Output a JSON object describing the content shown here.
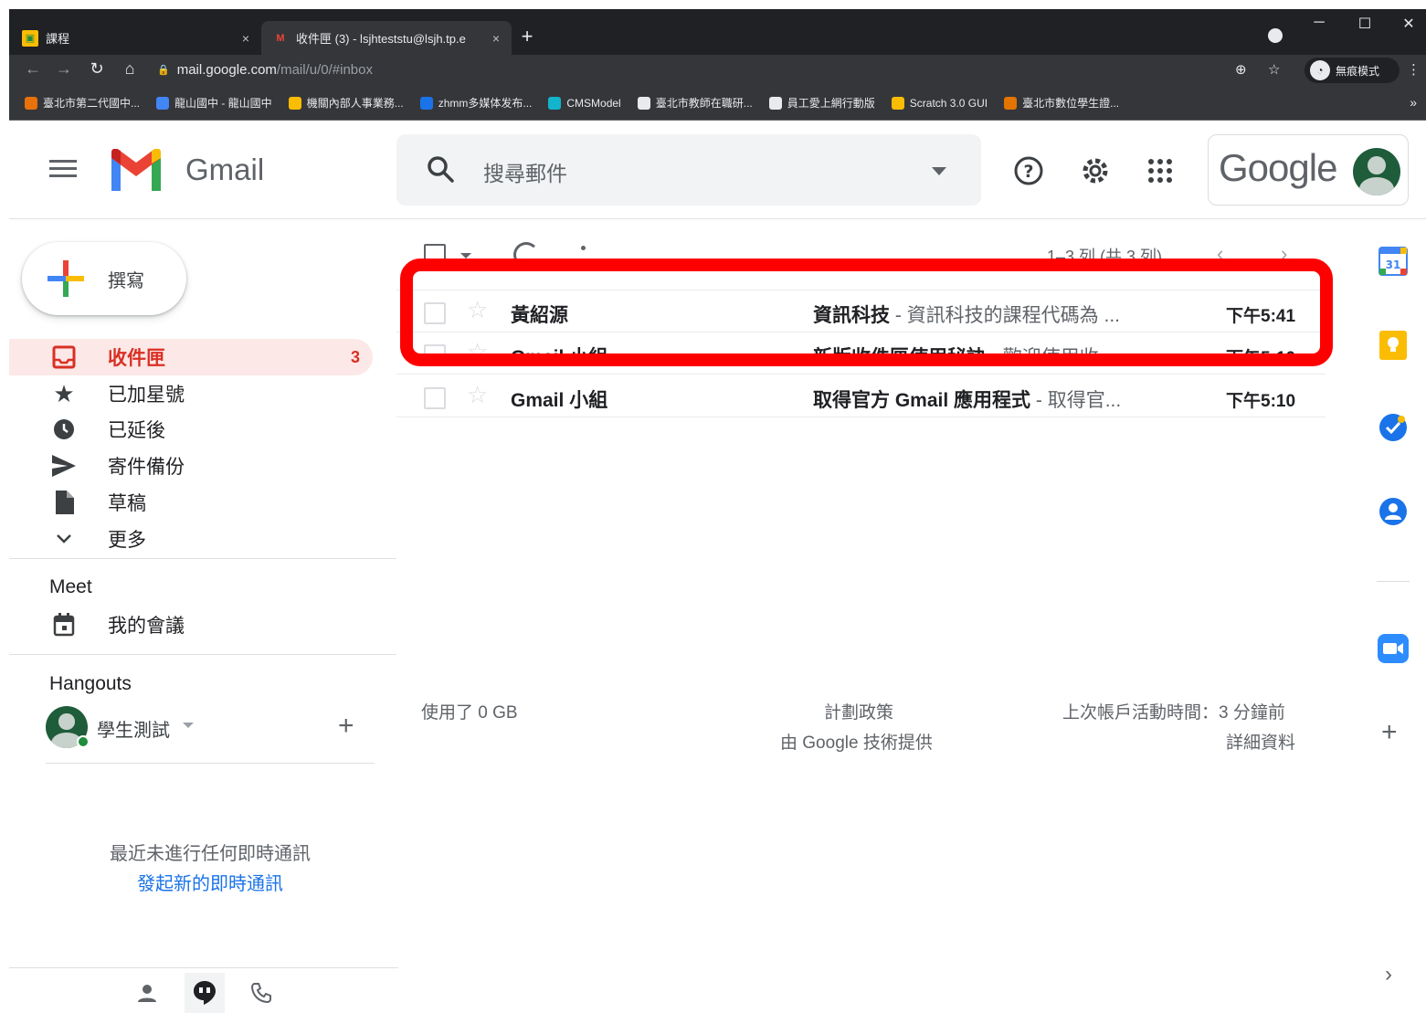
{
  "browser": {
    "tabs": [
      {
        "title": "課程",
        "close": "×"
      },
      {
        "title": "收件匣 (3) - lsjhteststu@lsjh.tp.e",
        "close": "×"
      }
    ],
    "new_tab": "+",
    "window_controls": [
      "─",
      "☐",
      "✕"
    ],
    "url_host": "mail.google.com",
    "url_path": "/mail/u/0/#inbox",
    "incognito_label": "無痕模式",
    "bookmarks": [
      {
        "label": "臺北市第二代國中...",
        "color": "#e8710a"
      },
      {
        "label": "龍山國中 - 龍山國中",
        "color": "#4285f4"
      },
      {
        "label": "機關內部人事業務...",
        "color": "#fbbc04"
      },
      {
        "label": "zhmm多媒体发布...",
        "color": "#1a73e8"
      },
      {
        "label": "CMSModel",
        "color": "#12b5cb"
      },
      {
        "label": "臺北市教師在職研...",
        "color": "#e8eaed"
      },
      {
        "label": "員工愛上網行動版",
        "color": "#e8eaed"
      },
      {
        "label": "Scratch 3.0 GUI",
        "color": "#fbbc04"
      },
      {
        "label": "臺北市數位學生證...",
        "color": "#e37400"
      }
    ],
    "bookmarks_more": "»"
  },
  "header": {
    "app_name": "Gmail",
    "search_placeholder": "搜尋郵件",
    "google_label": "Google"
  },
  "sidebar": {
    "compose_label": "撰寫",
    "items": [
      {
        "label": "收件匣",
        "count": "3",
        "icon": "inbox-icon"
      },
      {
        "label": "已加星號",
        "count": "",
        "icon": "star-icon"
      },
      {
        "label": "已延後",
        "count": "",
        "icon": "clock-icon"
      },
      {
        "label": "寄件備份",
        "count": "",
        "icon": "send-icon"
      },
      {
        "label": "草稿",
        "count": "",
        "icon": "draft-icon"
      },
      {
        "label": "更多",
        "count": "",
        "icon": "chevron-down-icon"
      }
    ],
    "meet_title": "Meet",
    "meet_item": "我的會議",
    "hangouts_title": "Hangouts",
    "hangouts_user": "學生測試",
    "no_chat": "最近未進行任何即時通訊",
    "new_chat": "發起新的即時通訊"
  },
  "list": {
    "pager": "1–3 列 (共 3 列)",
    "rows": [
      {
        "sender": "黃紹源",
        "subject": "資訊科技",
        "snippet": " - 資訊科技的課程代碼為 ...",
        "time": "下午5:41"
      },
      {
        "sender": "Gmail 小組",
        "subject": "新版收件匣使用秘訣",
        "snippet": " - 歡迎使用收...",
        "time": "下午5:10"
      },
      {
        "sender": "Gmail 小組",
        "subject": "取得官方 Gmail 應用程式",
        "snippet": " - 取得官...",
        "time": "下午5:10"
      }
    ]
  },
  "footer": {
    "storage": "使用了 0 GB",
    "policy": "計劃政策",
    "powered": "由 Google 技術提供",
    "activity": "上次帳戶活動時間：3 分鐘前",
    "details": "詳細資料"
  },
  "colors": {
    "accent_red": "#d93025",
    "highlight_red": "#ff0000",
    "link_blue": "#1a73e8"
  }
}
